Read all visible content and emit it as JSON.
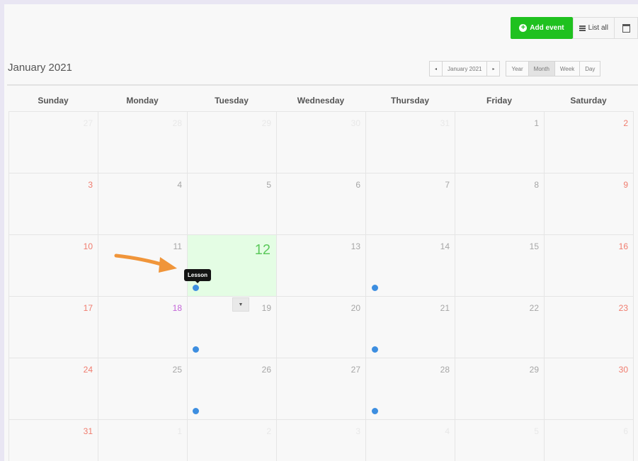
{
  "toolbar": {
    "add_event_label": "Add event",
    "list_all_label": "List all",
    "add_icon": "plus-circle-icon",
    "list_icon": "list-icon",
    "calendar_icon": "calendar-icon",
    "accent_color": "#1fc11f"
  },
  "header": {
    "title": "January 2021",
    "prev": "◂",
    "current_month": "January 2021",
    "next": "▸",
    "views": [
      "Year",
      "Month",
      "Week",
      "Day"
    ],
    "active_view": "Month"
  },
  "weekdays": [
    "Sunday",
    "Monday",
    "Tuesday",
    "Wednesday",
    "Thursday",
    "Friday",
    "Saturday"
  ],
  "weeks": [
    [
      "27",
      "28",
      "29",
      "30",
      "31",
      "1",
      "2"
    ],
    [
      "3",
      "4",
      "5",
      "6",
      "7",
      "8",
      "9"
    ],
    [
      "10",
      "11",
      "12",
      "13",
      "14",
      "15",
      "16"
    ],
    [
      "17",
      "18",
      "19",
      "20",
      "21",
      "22",
      "23"
    ],
    [
      "24",
      "25",
      "26",
      "27",
      "28",
      "29",
      "30"
    ],
    [
      "31",
      "1",
      "2",
      "3",
      "4",
      "5",
      "6"
    ]
  ],
  "today": "12",
  "tooltip": "Lesson",
  "dropdown_icon": "chevron-down-icon",
  "colors": {
    "weekend": "#f07c6e",
    "today_bg": "#e4fde4",
    "today_text": "#5cc95c",
    "event_dot": "#3d8ee0",
    "annotation_arrow": "#f0953a"
  }
}
